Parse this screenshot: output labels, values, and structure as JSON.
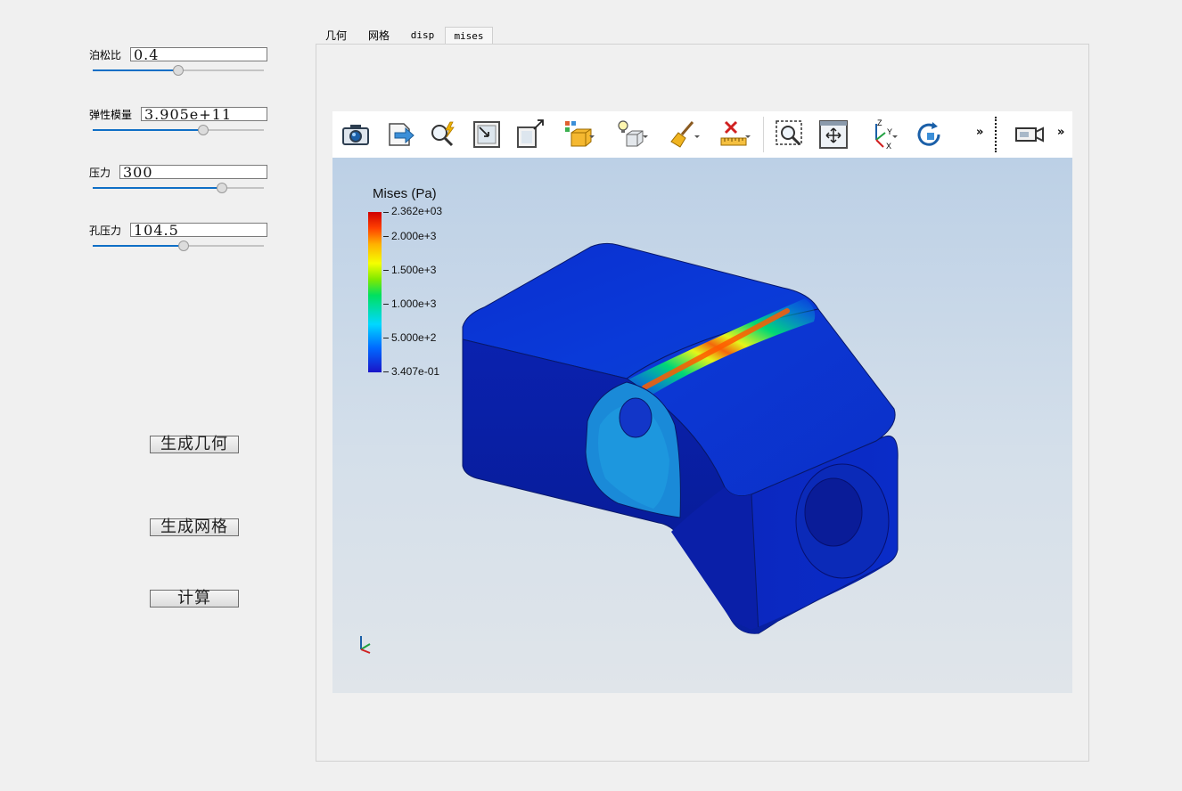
{
  "params": [
    {
      "label": "泊松比",
      "value": "0.4",
      "slider": 0.5
    },
    {
      "label": "弹性模量",
      "value": "3.905e+11",
      "slider": 0.65
    },
    {
      "label": "压力",
      "value": "300",
      "slider": 0.75
    },
    {
      "label": "孔压力",
      "value": "104.5",
      "slider": 0.53
    }
  ],
  "buttons": {
    "gen_geometry": "生成几何",
    "gen_mesh": "生成网格",
    "compute": "计算"
  },
  "tabs": [
    {
      "label": "几何",
      "active": false
    },
    {
      "label": "网格",
      "active": false
    },
    {
      "label": "disp",
      "active": false
    },
    {
      "label": "mises",
      "active": true
    }
  ],
  "toolbar": {
    "icons": [
      "camera-icon",
      "export-icon",
      "zoom-to-data-icon",
      "reset-camera-icon",
      "auto-scale-icon",
      "representation-icon",
      "light-cube-icon",
      "broom-icon",
      "ruler-delete-icon",
      "zoom-box-icon",
      "fit-view-icon",
      "axes-orient-icon",
      "rotate-icon",
      "camera-video-icon"
    ],
    "overflow_1": "»",
    "overflow_2": "»"
  },
  "colorbar": {
    "title": "Mises (Pa)",
    "max": "2.362e+03",
    "labels": [
      "2.000e+3",
      "1.500e+3",
      "1.000e+3",
      "5.000e+2"
    ],
    "min": "3.407e-01"
  },
  "axes_widget": {
    "z": "Z",
    "y": "Y",
    "x": "X"
  }
}
